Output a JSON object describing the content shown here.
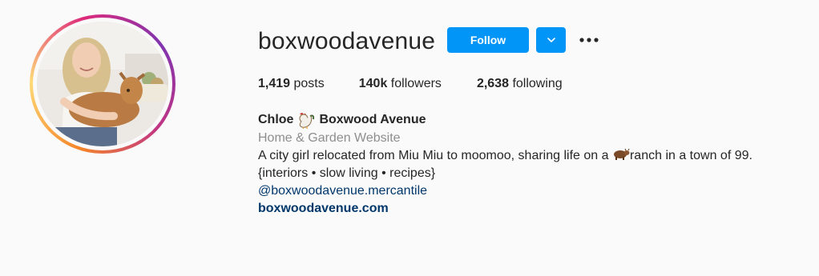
{
  "profile": {
    "username": "boxwoodavenue",
    "follow_label": "Follow",
    "dropdown_icon": "chevron-down-icon",
    "more_icon": "more-options-icon",
    "accent_color": "#0095f6"
  },
  "stats": {
    "posts_count": "1,419",
    "posts_label": "posts",
    "followers_count": "140k",
    "followers_label": "followers",
    "following_count": "2,638",
    "following_label": "following"
  },
  "bio": {
    "name_first": "Chloe",
    "name_emoji": "rooster-emoji",
    "name_last": "Boxwood Avenue",
    "category": "Home & Garden Website",
    "line1_part1": "A city girl relocated from Miu Miu to moomoo, sharing life on a",
    "line1_emoji": "cow-emoji",
    "line1_part2": "ranch in a town of",
    "line1_cont": "99.",
    "line2": "{interiors • slow living • recipes}",
    "mention": "@boxwoodavenue.mercantile",
    "website": "boxwoodavenue.com"
  }
}
